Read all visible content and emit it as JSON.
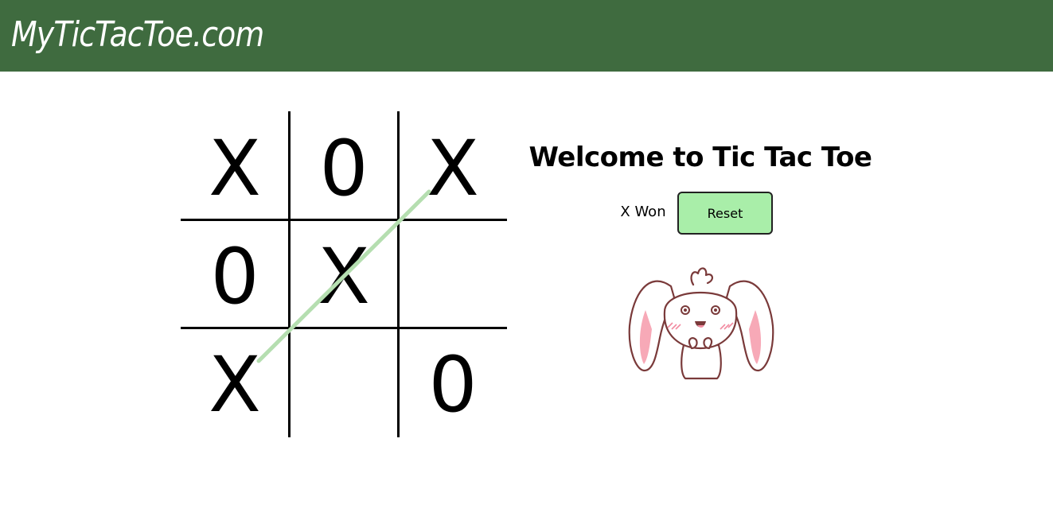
{
  "header": {
    "brand": "MyTicTacToe.com",
    "background_color": "#3f6b3f"
  },
  "game": {
    "cells": [
      "X",
      "0",
      "X",
      "0",
      "X",
      "",
      "X",
      "",
      "0"
    ],
    "winner_line": "anti-diagonal",
    "winning_line_color": "#b5deb0"
  },
  "panel": {
    "title": "Welcome to Tic Tac Toe",
    "status": "X Won",
    "reset_label": "Reset",
    "reset_color": "#a9eea9",
    "mascot_icon": "bunny-mascot-icon"
  }
}
